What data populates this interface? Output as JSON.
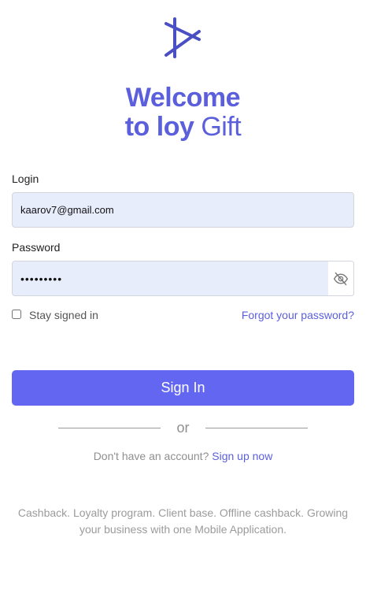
{
  "brand": {
    "logo_icon": "loy-gift-logo-icon",
    "color": "#5b5fdc",
    "title_line1": "Welcome",
    "title_line2_bold": "to loy",
    "title_line2_thin": "Gift"
  },
  "form": {
    "login_label": "Login",
    "login_value": "kaarov7@gmail.com",
    "password_label": "Password",
    "password_value": "•••••••••",
    "toggle_visibility_icon": "eye-off-icon",
    "stay_signed_in_label": "Stay signed in",
    "stay_signed_in_checked": false,
    "forgot_link": "Forgot your password?",
    "submit_label": "Sign In",
    "submit_color": "#6366f1"
  },
  "separator": {
    "text": "or"
  },
  "signup": {
    "prompt": "Don't have an account?",
    "link": "Sign up now"
  },
  "footer": {
    "text": "Cashback. Loyalty program. Client base. Offline cashback. Growing your business with one Mobile Application."
  }
}
